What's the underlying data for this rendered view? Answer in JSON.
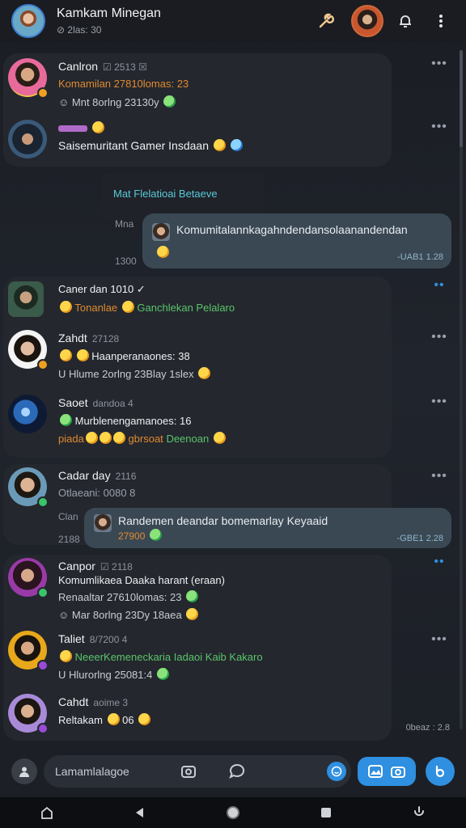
{
  "header": {
    "title": "Kamkam Minegan",
    "subtitle": "⊘ 2las: 30"
  },
  "messages": [
    {
      "id": "m1",
      "name": "Canlron",
      "meta": "☑ 2513 ☒",
      "line2": "Komamilan 27810lomas: 23",
      "line3": "☺ Mnt 8orlng 23130y"
    },
    {
      "id": "m2",
      "name": "",
      "meta": "",
      "line2": "Saisemuritant Gamer Insdaan",
      "line3": ""
    },
    {
      "id": "m3",
      "name": "Caner dan 1010 ✓",
      "meta": "",
      "line2": "Tonanlae",
      "line2b": "Ganchlekan Pelalaro",
      "line3": ""
    },
    {
      "id": "m4",
      "name": "Zahdt",
      "meta": "27128",
      "line2": "Haanperanaones: 38",
      "line3": "U Hlume 2orlng 23Blay 1slex"
    },
    {
      "id": "m5",
      "name": "Saoet",
      "meta": "dandoa 4",
      "line2": "Murblenengamanoes: 16",
      "line3": "piada",
      "line3b": "gbrsoat",
      "line3c": "Deenoan"
    },
    {
      "id": "m6",
      "name": "Cadar day",
      "meta": "2116",
      "line2": "Otlaeani: 0080 8",
      "line3": ""
    },
    {
      "id": "m7",
      "name": "Canpor",
      "meta": "☑ 2118",
      "line2": "Komumlikaea Daaka harant (eraan)",
      "line3": "Renaaltar 27610lomas: 23",
      "line4": "☺ Mar 8orlng 23Dy 18aea"
    },
    {
      "id": "m8",
      "name": "Taliet",
      "meta": "8/7200 4",
      "line2": "NeeerKemeneckaria Iadaoi Kaib Kakaro",
      "line3": "U Hlurorlng 25081:4"
    },
    {
      "id": "m9",
      "name": "Cahdt",
      "meta": "aoime 3",
      "line2": "Reltakam",
      "line2b": "06",
      "line3": ""
    }
  ],
  "system_note": "Mat Flelatioai Betaeve",
  "reply1": {
    "label_top": "Mna",
    "label_bottom": "1300",
    "text": "Komumitalannkagahndendansolaanandendan",
    "time": "-UAB1 1.28"
  },
  "reply2": {
    "label_top": "Clan",
    "label_bottom": "2188",
    "text": "Randemen deandar bomemarlay Keyaaid",
    "sub": "27900",
    "time": "-GBE1 2.28"
  },
  "floating_time": "0beaz : 2.8",
  "composer": {
    "placeholder": "Lamamlalagoe"
  },
  "colors": {
    "accent": "#2f8fe0",
    "orange": "#e08a2e",
    "green": "#5ac46a",
    "cyan": "#5ac8d8"
  }
}
